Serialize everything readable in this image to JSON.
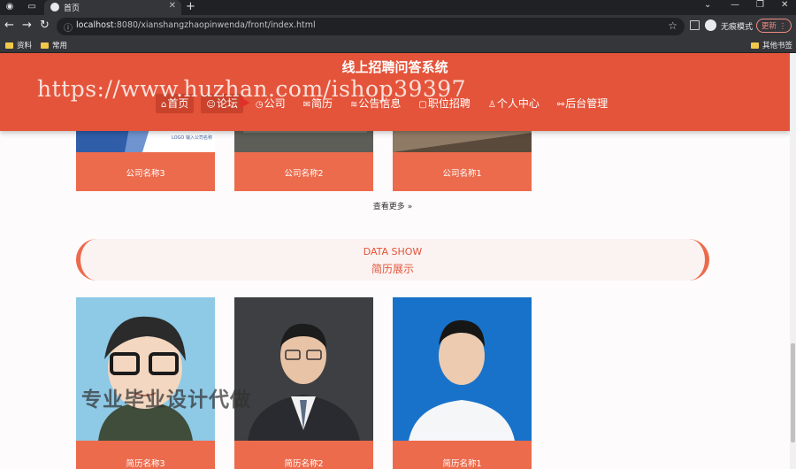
{
  "browser": {
    "tab_title": "首页",
    "url_host": "localhost",
    "url_rest": ":8080/xianshangzhaopinwenda/front/index.html",
    "incognito_label": "无痕模式",
    "update_label": "更新",
    "bookmarks": [
      "资料",
      "常用"
    ],
    "other_bookmarks": "其他书签"
  },
  "header": {
    "site_title": "线上招聘问答系统",
    "watermark": "https://www.huzhan.com/ishop39397",
    "nav": [
      {
        "icon": "home-icon",
        "glyph": "⌂",
        "label": "首页"
      },
      {
        "icon": "forum-icon",
        "glyph": "☺",
        "label": "论坛"
      },
      {
        "icon": "company-icon",
        "glyph": "◷",
        "label": "公司"
      },
      {
        "icon": "resume-icon",
        "glyph": "✉",
        "label": "简历"
      },
      {
        "icon": "notice-icon",
        "glyph": "≋",
        "label": "公告信息"
      },
      {
        "icon": "job-icon",
        "glyph": "▢",
        "label": "职位招聘"
      },
      {
        "icon": "user-icon",
        "glyph": "♙",
        "label": "个人中心"
      },
      {
        "icon": "admin-icon",
        "glyph": "⚯",
        "label": "后台管理"
      }
    ]
  },
  "companies": [
    {
      "name": "公司名称3",
      "logo_text": "LOGO 输入公司名称"
    },
    {
      "name": "公司名称2"
    },
    {
      "name": "公司名称1"
    }
  ],
  "more_label": "查看更多",
  "data_show": {
    "en": "DATA SHOW",
    "cn": "简历展示"
  },
  "resumes": [
    {
      "name": "简历名称3"
    },
    {
      "name": "简历名称2"
    },
    {
      "name": "简历名称1"
    }
  ],
  "overlay_text": "专业毕业设计代做",
  "colors": {
    "primary": "#e4543a",
    "card": "#ec6b4c"
  }
}
